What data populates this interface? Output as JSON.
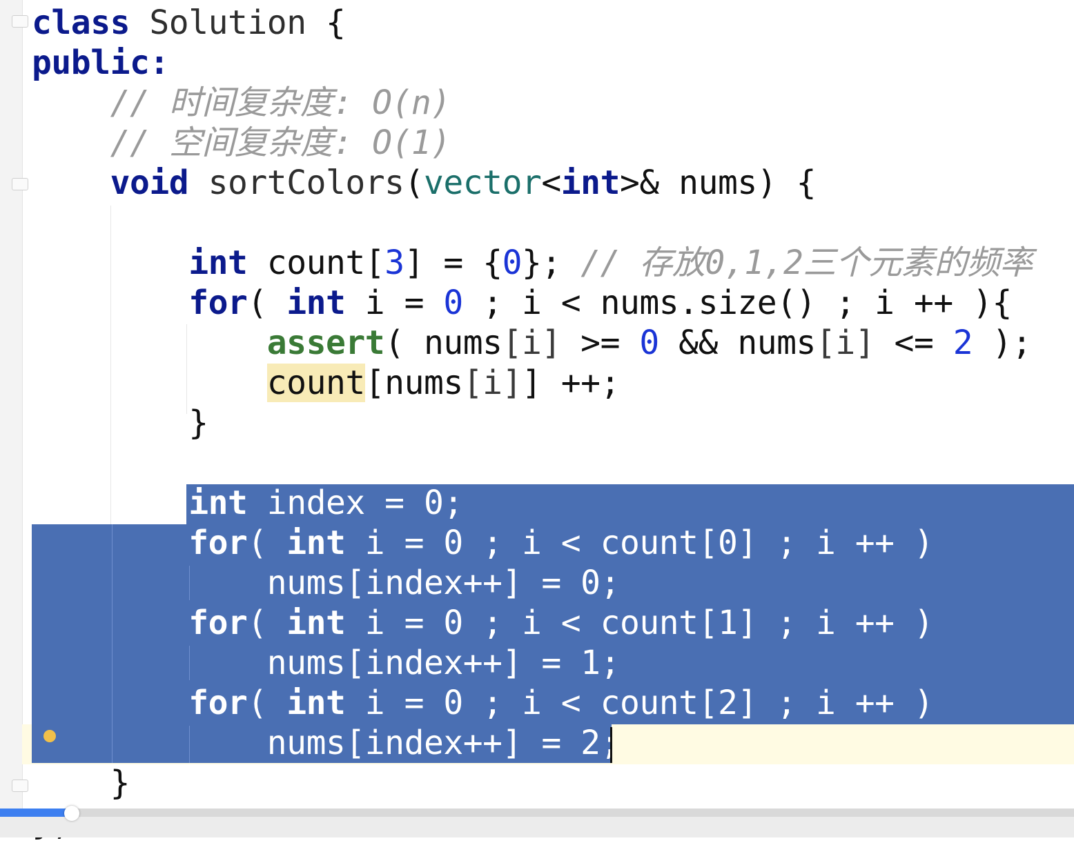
{
  "editor": {
    "language": "C++",
    "lines": [
      "class Solution {",
      "public:",
      "    // 时间复杂度: O(n)",
      "    // 空间复杂度: O(1)",
      "    void sortColors(vector<int>& nums) {",
      "",
      "        int count[3] = {0}; // 存放0,1,2三个元素的频率",
      "        for( int i = 0 ; i < nums.size() ; i ++ ){",
      "            assert( nums[i] >= 0 && nums[i] <= 2 );",
      "            count[nums[i]] ++;",
      "        }",
      "",
      "        int index = 0;",
      "        for( int i = 0 ; i < count[0] ; i ++ )",
      "            nums[index++] = 0;",
      "        for( int i = 0 ; i < count[1] ; i ++ )",
      "            nums[index++] = 1;",
      "        for( int i = 0 ; i < count[2] ; i ++ )",
      "            nums[index++] = 2;",
      "    }",
      "};"
    ],
    "selection": {
      "from_line": 13,
      "to_line": 19,
      "selection_color": "#4a6fb3"
    },
    "highlighted_identifier": "count",
    "gutter_icons": [
      "fold-marker-icon",
      "lightbulb-icon"
    ]
  },
  "player": {
    "progress_fraction": 0.067,
    "progress_color": "#3d7ff0"
  },
  "colors": {
    "keyword": "#0b1a8c",
    "number": "#1a34d6",
    "comment": "#9a9a9a",
    "type": "#1b6f6a",
    "assert": "#3a7a36",
    "current_line": "#fffbe3"
  }
}
